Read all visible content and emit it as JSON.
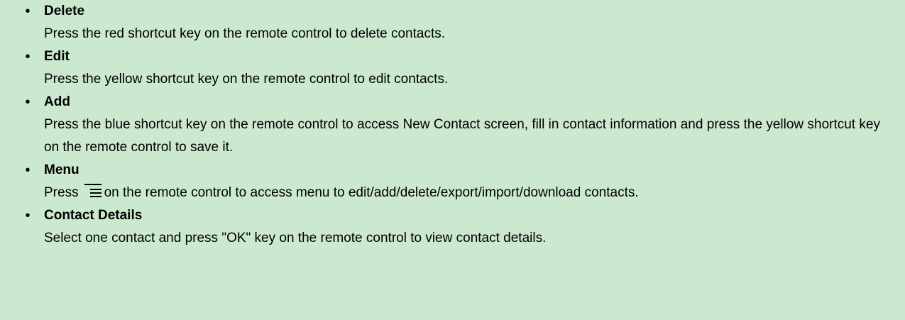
{
  "bullet_glyph": "•",
  "items": [
    {
      "title": "Delete",
      "description": "Press the red shortcut key on the remote control to delete contacts."
    },
    {
      "title": "Edit",
      "description": "Press the yellow shortcut key on the remote control to edit contacts."
    },
    {
      "title": "Add",
      "description": "Press the blue shortcut key on the remote control to access New Contact screen, fill in contact information and press the yellow shortcut key on the remote control to save it."
    },
    {
      "title": "Menu",
      "description_before_icon": "Press",
      "icon": "menu-icon",
      "description_after_icon": "on the remote control to access menu to edit/add/delete/export/import/download contacts."
    },
    {
      "title": "Contact Details",
      "description": "Select one contact and press \"OK\" key on the remote control to view contact details."
    }
  ],
  "colors": {
    "background": "#cce8cf",
    "text": "#000000"
  }
}
